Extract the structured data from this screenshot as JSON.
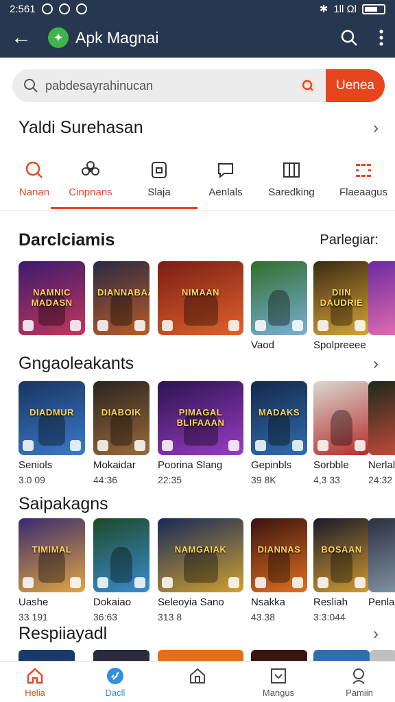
{
  "status": {
    "time": "2:561",
    "icons": [
      "bluetooth-icon",
      "signal-icon",
      "battery-icon"
    ],
    "network": "1ll Ωl"
  },
  "appbar": {
    "title": "Apk Magnai",
    "back_icon": "back-arrow-icon",
    "logo_icon": "app-logo-icon",
    "search_icon": "search-icon",
    "menu_icon": "more-vert-icon"
  },
  "search": {
    "value": "pabdesayrahinucan",
    "button_label": "Uenea"
  },
  "header": {
    "title": "Yaldi Surehasan"
  },
  "categories": [
    {
      "label": "Nanan",
      "icon": "search-circle-icon",
      "active": true
    },
    {
      "label": "Cinpnans",
      "icon": "flower-icon",
      "active": true
    },
    {
      "label": "Slaja",
      "icon": "app-tile-icon",
      "active": false
    },
    {
      "label": "Aenlals",
      "icon": "chat-icon",
      "active": false
    },
    {
      "label": "Saredking",
      "icon": "columns-icon",
      "active": false
    },
    {
      "label": "Flaeaagus",
      "icon": "grid-dots-icon",
      "active": false
    }
  ],
  "sections": [
    {
      "title": "Darclciamis",
      "aside": "Parlegiar:",
      "items": [
        {
          "banner": "NAMNIC MADASN",
          "caption": "",
          "sub": "",
          "colors": [
            "#3b1b6e",
            "#c4365a"
          ]
        },
        {
          "banner": "DIANNABAANOU",
          "caption": "",
          "sub": "",
          "colors": [
            "#2b2a44",
            "#b85b26"
          ]
        },
        {
          "banner": "NIMAAN",
          "caption": "",
          "sub": "",
          "colors": [
            "#7a1e16",
            "#e0622a"
          ]
        },
        {
          "banner": "",
          "caption": "Vaod",
          "sub": "",
          "colors": [
            "#2f6f2b",
            "#7ab0d8"
          ]
        },
        {
          "banner": "DIIN DAUDRIE",
          "caption": "Spolpreeee",
          "sub": "",
          "colors": [
            "#3b2a14",
            "#d7a436"
          ]
        }
      ]
    },
    {
      "title": "Gngaoleakants",
      "aside": "",
      "items": [
        {
          "banner": "DIADMUR",
          "caption": "Seniols",
          "sub": "3:0 09",
          "colors": [
            "#1a3460",
            "#3a7bc9"
          ]
        },
        {
          "banner": "DIABOIK",
          "caption": "Mokaidar",
          "sub": "44:36",
          "colors": [
            "#2a2420",
            "#9a6a3a"
          ]
        },
        {
          "banner": "PIMAGAL BLIFAAAN",
          "caption": "Poorina Slang",
          "sub": "22:35",
          "colors": [
            "#2c1450",
            "#9a3cc4"
          ]
        },
        {
          "banner": "MADAKS",
          "caption": "Gepinbls",
          "sub": "39 8K",
          "colors": [
            "#16284a",
            "#2f6eb0"
          ]
        },
        {
          "banner": "",
          "caption": "Sorbble",
          "sub": "4,3 33",
          "colors": [
            "#d8d8d0",
            "#b82a2a"
          ]
        }
      ]
    },
    {
      "title": "Saipakagns",
      "aside": "",
      "items": [
        {
          "banner": "TIMIMAL",
          "caption": "Uashe",
          "sub": "33 191",
          "colors": [
            "#3a2a70",
            "#e0a640"
          ]
        },
        {
          "banner": "",
          "caption": "Dokaiao",
          "sub": "36:63",
          "colors": [
            "#1e4a2a",
            "#3a8cd0"
          ]
        },
        {
          "banner": "NAMGAIAK",
          "caption": "Seleoyia Sano",
          "sub": "313 8",
          "colors": [
            "#162a5a",
            "#d0a030"
          ]
        },
        {
          "banner": "DIANNAS",
          "caption": "Nsakka",
          "sub": "43.38",
          "colors": [
            "#3a1410",
            "#e07020"
          ]
        },
        {
          "banner": "BOSAAN",
          "caption": "Resliah",
          "sub": "3:3:044",
          "colors": [
            "#1a1a2a",
            "#d09a30"
          ]
        }
      ]
    }
  ],
  "overflow": [
    {
      "caption": "",
      "sub": "",
      "colors": [
        "#6a2aa0",
        "#e06ab0"
      ]
    },
    {
      "caption": "Nerlal",
      "sub": "24:32",
      "colors": [
        "#1a2a1a",
        "#c04a3a"
      ]
    },
    {
      "caption": "Penla",
      "sub": "",
      "colors": [
        "#2a3040",
        "#8090a0"
      ]
    }
  ],
  "next_section": {
    "title": "Respiiayadl"
  },
  "bottom_nav": [
    {
      "label": "Helia",
      "icon": "home-icon",
      "active": true
    },
    {
      "label": "Dacll",
      "icon": "link-icon",
      "active": true
    },
    {
      "label": "",
      "icon": "house-outline-icon",
      "active": false
    },
    {
      "label": "Mangus",
      "icon": "inbox-icon",
      "active": false
    },
    {
      "label": "Pamiin",
      "icon": "person-search-icon",
      "active": false
    }
  ],
  "accent": "#e8451f",
  "appbar_bg": "#26374f"
}
